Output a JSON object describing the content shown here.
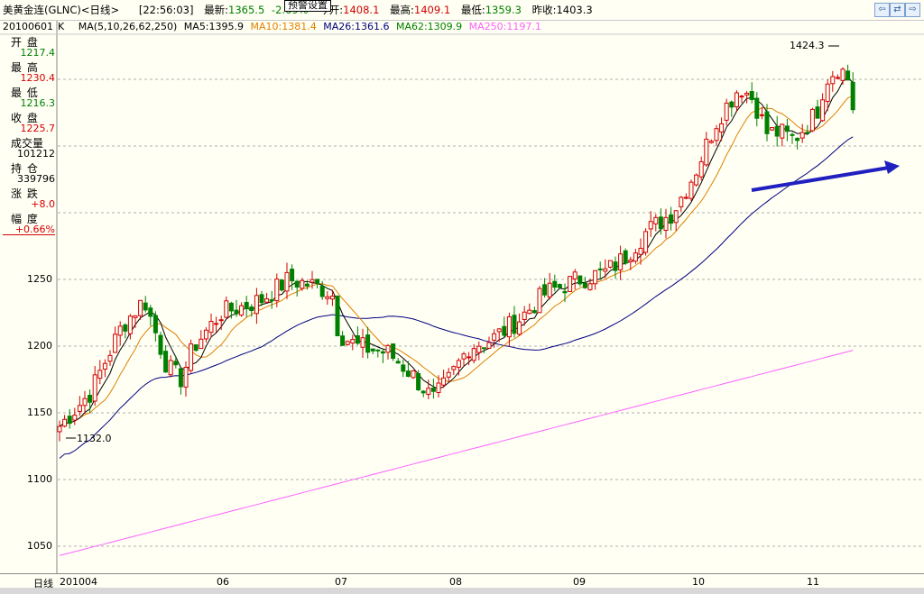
{
  "header": {
    "title": "美黄金连(GLNC)<日线>",
    "time": "[22:56:03]",
    "latest_label": "最新:",
    "latest_value": "1365.5",
    "change_pct": "-2.69%",
    "open_label": "今开:",
    "open_value": "1408.1",
    "high_label": "最高:",
    "high_value": "1409.1",
    "low_label": "最低:",
    "low_value": "1359.3",
    "prev_label": "昨收:",
    "prev_value": "1403.3",
    "popup_label": "预警设置",
    "nav_prev": "⇦",
    "nav_switch": "⇄",
    "nav_next": "⇨"
  },
  "legend": {
    "k_label": "K",
    "ma_params": "MA(5,10,26,62,250)",
    "ma5": "MA5:1395.9",
    "ma10": "MA10:1381.4",
    "ma26": "MA26:1361.6",
    "ma62": "MA62:1309.9",
    "ma250": "MA250:1197.1"
  },
  "info_panel": {
    "date": "20100601",
    "open_label": "开 盘",
    "open": "1217.4",
    "high_label": "最 高",
    "high": "1230.4",
    "low_label": "最 低",
    "low": "1216.3",
    "close_label": "收 盘",
    "close": "1225.7",
    "volume_label": "成交量",
    "volume": "101212",
    "position_label": "持 仓",
    "position": "339796",
    "change_label": "涨 跌",
    "change": "+8.0",
    "range_label": "幅 度",
    "range": "+0.66%"
  },
  "chart": {
    "y_ticks": [
      "1250",
      "1200",
      "1150",
      "1100",
      "1050"
    ],
    "x_labels": [
      "201004",
      "06",
      "07",
      "08",
      "09",
      "10",
      "11"
    ],
    "period_label": "日线",
    "max_annotation": "1424.3",
    "min_annotation": "1132.0",
    "colors": {
      "up": "#d40000",
      "down": "#008000",
      "ma5": "#000000",
      "ma10": "#e08000",
      "ma26": "#000080",
      "ma250": "#ff60ff",
      "trend": "#2020c0",
      "grid": "#b0b0b0"
    }
  }
}
